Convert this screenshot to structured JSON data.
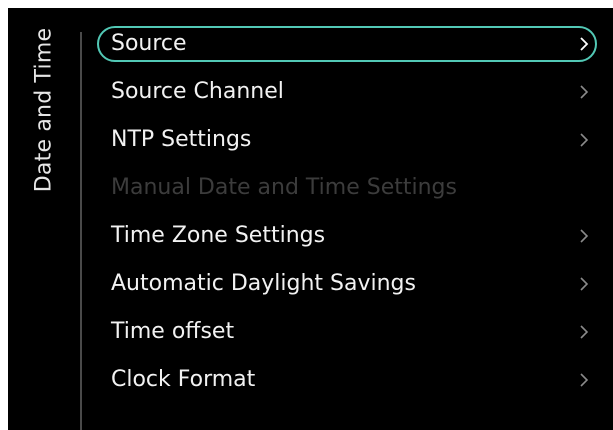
{
  "panel": {
    "title": "Date and Time"
  },
  "menu": {
    "items": [
      {
        "label": "Source",
        "state": "selected",
        "has_submenu": true,
        "icon": "chevron-right-icon"
      },
      {
        "label": "Source Channel",
        "state": "normal",
        "has_submenu": true,
        "icon": "chevron-right-icon"
      },
      {
        "label": "NTP Settings",
        "state": "normal",
        "has_submenu": true,
        "icon": "chevron-right-icon"
      },
      {
        "label": "Manual Date and Time Settings",
        "state": "disabled",
        "has_submenu": false
      },
      {
        "label": "Time Zone Settings",
        "state": "normal",
        "has_submenu": true,
        "icon": "chevron-right-icon"
      },
      {
        "label": "Automatic Daylight Savings",
        "state": "normal",
        "has_submenu": true,
        "icon": "chevron-right-icon"
      },
      {
        "label": "Time offset",
        "state": "normal",
        "has_submenu": true,
        "icon": "chevron-right-icon"
      },
      {
        "label": "Clock Format",
        "state": "normal",
        "has_submenu": true,
        "icon": "chevron-right-icon"
      }
    ]
  },
  "colors": {
    "background": "#000000",
    "text": "#f2f2f2",
    "disabled_text": "#3c3c3c",
    "focus_outline": "#52c8b5",
    "divider": "#4a4a4a"
  }
}
